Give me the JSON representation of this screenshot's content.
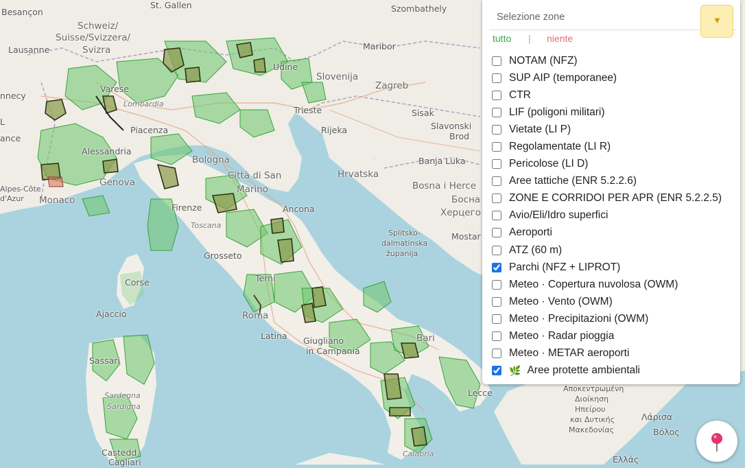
{
  "map": {
    "labels": {
      "besancon": "Besançon",
      "schweiz": "Schweiz/",
      "suisse": "Suisse/Svizzera/",
      "svizra": "Svizra",
      "lausanne": "Lausanne",
      "st_gallen": "St. Gallen",
      "udine": "Udine",
      "slovenija": "Slovenija",
      "maribor": "Maribor",
      "szombathely": "Szombathely",
      "zagreb": "Zagreb",
      "trieste": "Trieste",
      "rijeka": "Rijeka",
      "sisak": "Sisak",
      "slavonski": "Slavonski",
      "brod": "Brod",
      "banja_luka": "Banja Luka",
      "hrvatska": "Hrvatska",
      "bosna": "Bosna i Herce",
      "bosna_cyr": "Босна",
      "herceg_cyr": "Херцего",
      "mostar": "Mostar",
      "split_dal": "Splitsko-",
      "dalmatinska": "dalmatinska",
      "zupanija": "županija",
      "varese": "Varese",
      "lombardia": "Lombardia",
      "piacenza": "Piacenza",
      "alessandria": "Alessandria",
      "genova": "Genova",
      "bologna": "Bologna",
      "citta_di_san": "Città di San",
      "marino": "Marino",
      "firenze": "Firenze",
      "toscana": "Toscana",
      "ancona": "Ancona",
      "grosseto": "Grosseto",
      "terni": "Terni",
      "roma": "Roma",
      "latina": "Latina",
      "giugliano": "Giugliano",
      "in_campania": "in Campania",
      "bari": "Bari",
      "lecce": "Lecce",
      "monaco": "Monaco",
      "alpes": "Alpes-Côte",
      "dazur": "d'Azur",
      "corse": "Corse",
      "ajaccio": "Ajaccio",
      "sassari": "Sassari",
      "sardegna": "Sardegna",
      "sardigna": "Sardigna",
      "castedd": "Castedd",
      "cagliari": "Cagliari",
      "calabria": "Calabria",
      "nnecy": "nnecy",
      "l": "L",
      "ance": "ance",
      "apocentriki": "Αποκεντρωμένη",
      "dioikisi": "Διοίκηση",
      "ipeirou": "Ηπείρου",
      "kai_dytikis": "και Δυτικής",
      "makedonias": "Μακεδονίας",
      "larisa": "Λάρισα",
      "volos": "Βόλος",
      "ellas": "Ελλάς"
    }
  },
  "panel": {
    "select_placeholder": "Selezione zone",
    "dropdown_arrow": "▼",
    "select_all": "tutto",
    "separator": "|",
    "select_none": "niente",
    "layers": [
      {
        "label": "NOTAM (NFZ)",
        "checked": false
      },
      {
        "label": "SUP AIP (temporanee)",
        "checked": false
      },
      {
        "label": "CTR",
        "checked": false
      },
      {
        "label": "LIF (poligoni militari)",
        "checked": false
      },
      {
        "label": "Vietate (LI P)",
        "checked": false
      },
      {
        "label": "Regolamentate (LI R)",
        "checked": false
      },
      {
        "label": "Pericolose (LI D)",
        "checked": false
      },
      {
        "label": "Aree tattiche (ENR 5.2.2.6)",
        "checked": false
      },
      {
        "label": "ZONE E CORRIDOI PER APR (ENR 5.2.2.5)",
        "checked": false
      },
      {
        "label": "Avio/Eli/Idro superfici",
        "checked": false
      },
      {
        "label": "Aeroporti",
        "checked": false
      },
      {
        "label": "ATZ (60 m)",
        "checked": false
      },
      {
        "label": "Parchi (NFZ + LIPROT)",
        "checked": true
      },
      {
        "label": "Meteo · Copertura nuvolosa (OWM)",
        "checked": false
      },
      {
        "label": "Meteo · Vento (OWM)",
        "checked": false
      },
      {
        "label": "Meteo · Precipitazioni (OWM)",
        "checked": false
      },
      {
        "label": "Meteo · Radar pioggia",
        "checked": false
      },
      {
        "label": "Meteo · METAR aeroporti",
        "checked": false
      },
      {
        "label": "Aree protette ambientali",
        "checked": true,
        "icon": "leaf-icon"
      }
    ]
  },
  "colors": {
    "sea": "#aad3df",
    "land": "#f2efe9",
    "green_area": "#5cbf5c",
    "park": "#6b7a3a",
    "accent_checkbox": "#1a73e8",
    "tutto": "#3aa64b",
    "niente": "#ee6b6b",
    "dropdown_bg": "#fdeeb4",
    "pin": "#e8336b"
  },
  "locate_icon": "map-pin-icon"
}
